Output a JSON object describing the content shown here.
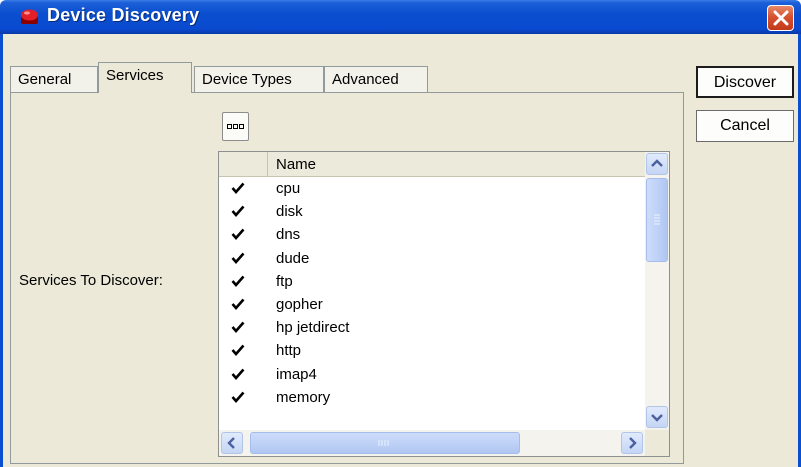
{
  "window": {
    "title": "Device Discovery",
    "title_bar_color": "#0a4fcf",
    "icon": "red-app-icon"
  },
  "tabs": [
    {
      "label": "General",
      "active": false
    },
    {
      "label": "Services",
      "active": true
    },
    {
      "label": "Device Types",
      "active": false
    },
    {
      "label": "Advanced",
      "active": false
    }
  ],
  "services": {
    "label": "Services To Discover:",
    "more_button_icon": "ellipsis-icon",
    "column_header": "Name",
    "rows": [
      {
        "checked": true,
        "name": "cpu"
      },
      {
        "checked": true,
        "name": "disk"
      },
      {
        "checked": true,
        "name": "dns"
      },
      {
        "checked": true,
        "name": "dude"
      },
      {
        "checked": true,
        "name": "ftp"
      },
      {
        "checked": true,
        "name": "gopher"
      },
      {
        "checked": true,
        "name": "hp jetdirect"
      },
      {
        "checked": true,
        "name": "http"
      },
      {
        "checked": true,
        "name": "imap4"
      },
      {
        "checked": true,
        "name": "memory"
      }
    ]
  },
  "buttons": {
    "discover": "Discover",
    "cancel": "Cancel"
  }
}
